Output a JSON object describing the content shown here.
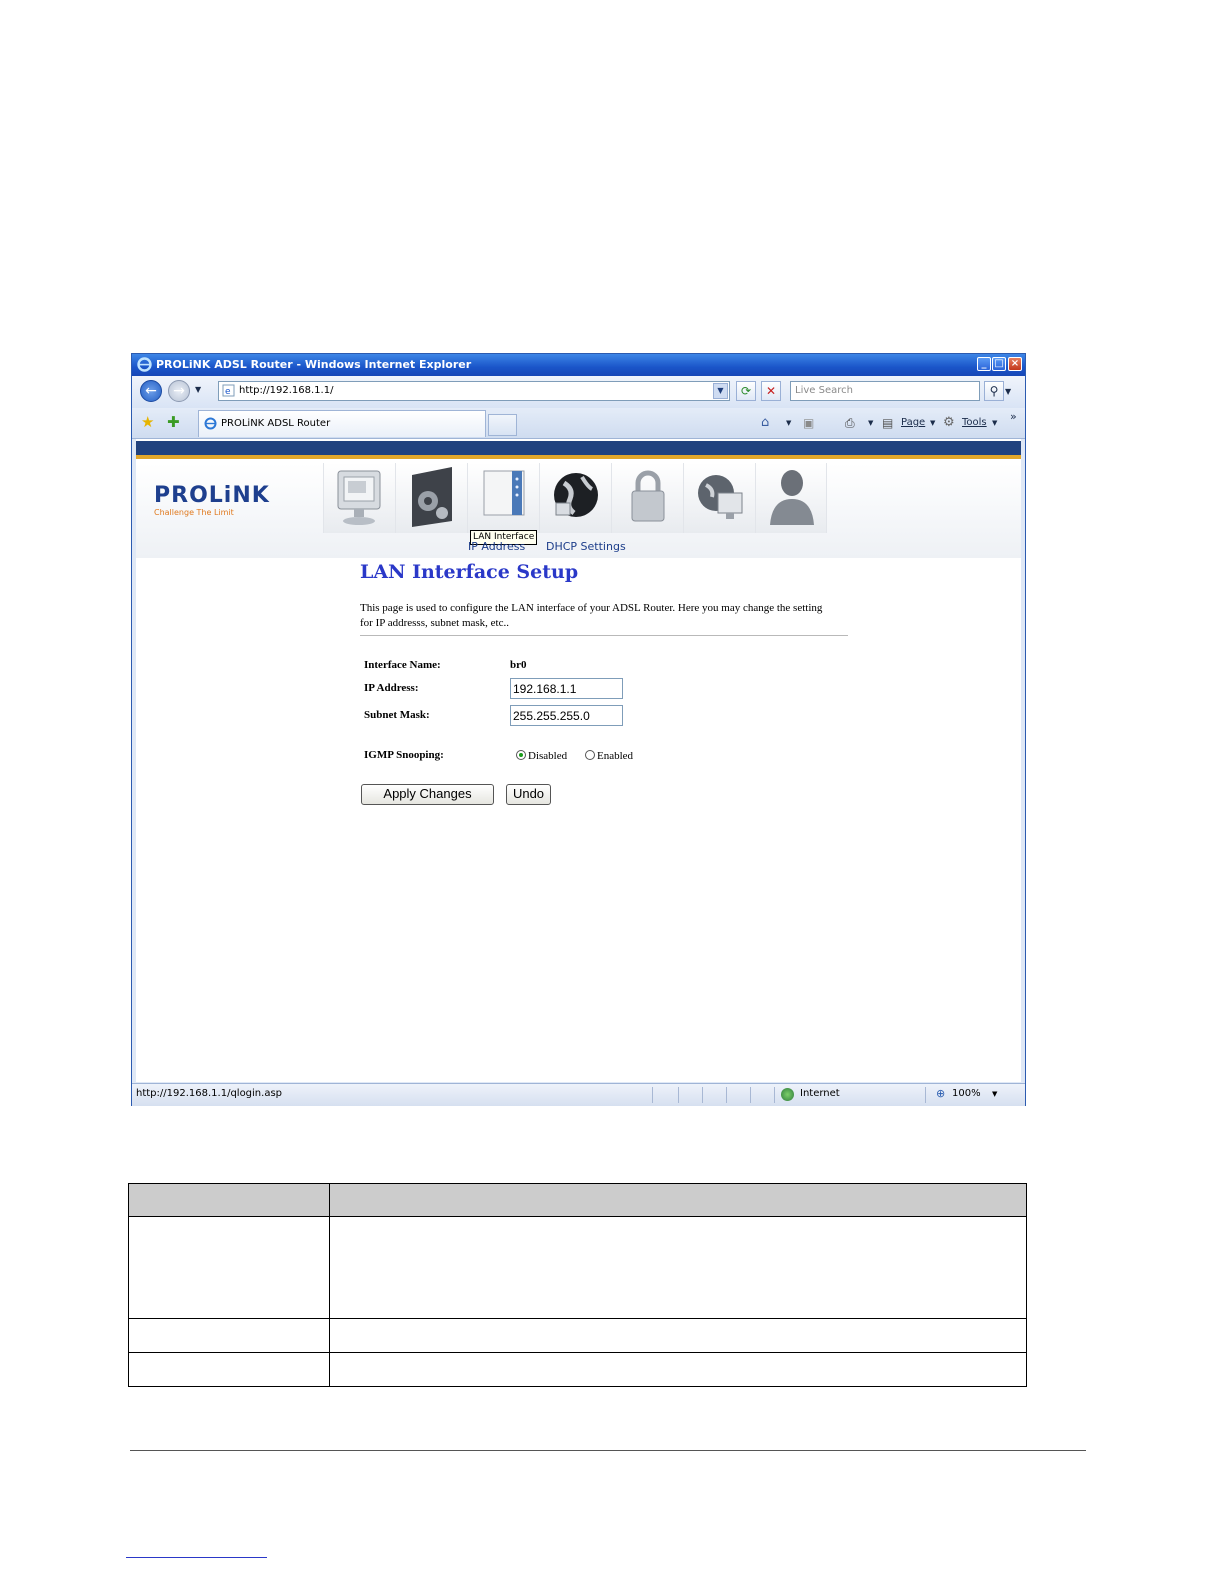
{
  "window": {
    "title": "PROLiNK ADSL Router - Windows Internet Explorer",
    "address": "http://192.168.1.1/",
    "search_placeholder": "Live Search",
    "tab_title": "PROLiNK ADSL Router",
    "cmd_page": "Page",
    "cmd_tools": "Tools",
    "status_url": "http://192.168.1.1/qlogin.asp",
    "status_zone": "Internet",
    "zoom": "100%"
  },
  "router": {
    "brand": "PROLiNK",
    "tagline": "Challenge The Limit",
    "menu_icons": [
      "status-icon",
      "setup-icon",
      "lan-interface-icon",
      "wan-icon",
      "security-icon",
      "internet-icon",
      "admin-icon"
    ],
    "tooltip": "LAN Interface",
    "submenu": [
      "IP Address",
      "DHCP Settings"
    ],
    "heading": "LAN Interface Setup",
    "description": "This page is used to configure the LAN interface of your ADSL Router. Here you may change the setting for IP addresss, subnet mask, etc..",
    "fields": {
      "interface_name_label": "Interface Name:",
      "interface_name_value": "br0",
      "ip_label": "IP Address:",
      "ip_value": "192.168.1.1",
      "mask_label": "Subnet Mask:",
      "mask_value": "255.255.255.0",
      "igmp_label": "IGMP Snooping:",
      "igmp_options": [
        "Disabled",
        "Enabled"
      ],
      "igmp_selected": "Disabled"
    },
    "buttons": {
      "apply": "Apply Changes",
      "undo": "Undo"
    }
  },
  "colors": {
    "title_bar": "#1a55c9",
    "header_stripe": "#21427e",
    "header_accent": "#e3a72a",
    "heading": "#2a38c8"
  }
}
